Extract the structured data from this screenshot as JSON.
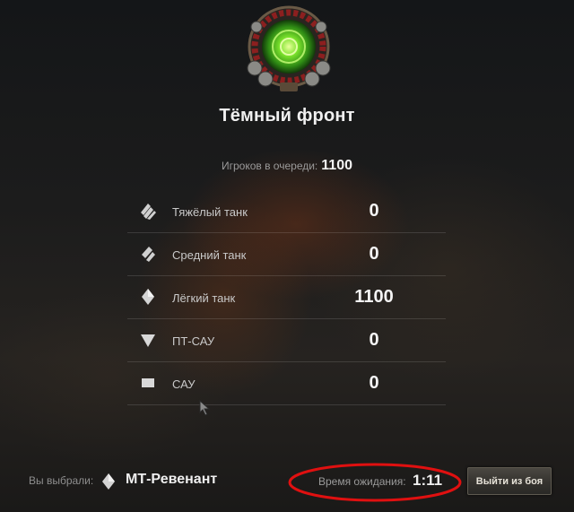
{
  "mode": {
    "title": "Тёмный фронт",
    "emblem_icon": "green-vortex-emblem-icon"
  },
  "queue": {
    "label": "Игроков в очереди:",
    "total": "1100"
  },
  "vehicle_classes": [
    {
      "icon": "heavy-tank-icon",
      "label": "Тяжёлый танк",
      "count": "0"
    },
    {
      "icon": "medium-tank-icon",
      "label": "Средний танк",
      "count": "0"
    },
    {
      "icon": "light-tank-icon",
      "label": "Лёгкий танк",
      "count": "1100"
    },
    {
      "icon": "tank-destroyer-icon",
      "label": "ПТ-САУ",
      "count": "0"
    },
    {
      "icon": "spg-icon",
      "label": "САУ",
      "count": "0"
    }
  ],
  "footer": {
    "selected_label": "Вы выбрали:",
    "selected_vehicle": "МТ-Ревенант",
    "selected_vehicle_icon": "light-tank-icon",
    "wait_label": "Время ожидания:",
    "wait_time": "1:11",
    "leave_button": "Выйти из боя"
  },
  "colors": {
    "annotation_ellipse": "#e01010",
    "emblem_glow": "#6fe02a"
  }
}
